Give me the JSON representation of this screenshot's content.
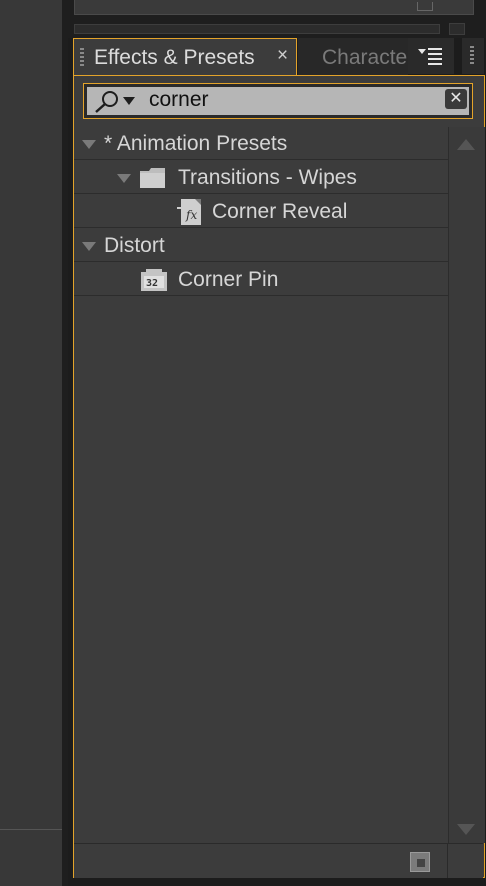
{
  "panel": {
    "tab_active": "Effects & Presets",
    "tab_close": "×",
    "tab_inactive": "Character"
  },
  "search": {
    "value": "corner",
    "clear_glyph": "✕"
  },
  "tree": [
    {
      "label": "* Animation Presets",
      "level": 0,
      "expanded": true,
      "icon": "none"
    },
    {
      "label": "Transitions - Wipes",
      "level": 1,
      "expanded": true,
      "icon": "folder-icon"
    },
    {
      "label": "Corner Reveal",
      "level": 2,
      "icon": "preset-file-icon"
    },
    {
      "label": "Distort",
      "level": 0,
      "expanded": true,
      "icon": "none"
    },
    {
      "label": "Corner Pin",
      "level": 1,
      "icon": "effect-32bit-icon"
    }
  ],
  "colors": {
    "accent": "#e3a32a",
    "panel_bg": "#3c3c3c",
    "text": "#d6d6d6"
  }
}
